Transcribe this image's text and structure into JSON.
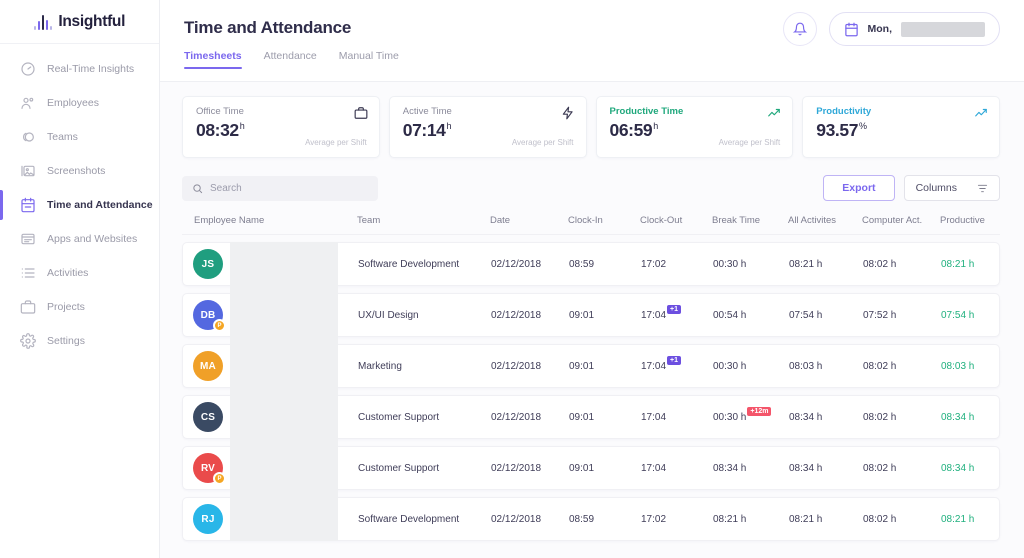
{
  "brand": {
    "name": "Insightful",
    "logo_icon": "waveform-icon",
    "accent": "#7b68ee"
  },
  "sidebar": {
    "items": [
      {
        "label": "Real-Time Insights",
        "icon": "gauge-icon",
        "active": false
      },
      {
        "label": "Employees",
        "icon": "people-icon",
        "active": false
      },
      {
        "label": "Teams",
        "icon": "teams-circles-icon",
        "active": false
      },
      {
        "label": "Screenshots",
        "icon": "image-icon",
        "active": false
      },
      {
        "label": "Time and Attendance",
        "icon": "calendar-icon",
        "active": true
      },
      {
        "label": "Apps and Websites",
        "icon": "window-list-icon",
        "active": false
      },
      {
        "label": "Activities",
        "icon": "list-icon",
        "active": false
      },
      {
        "label": "Projects",
        "icon": "briefcase-icon",
        "active": false
      },
      {
        "label": "Settings",
        "icon": "gear-icon",
        "active": false
      }
    ]
  },
  "header": {
    "title": "Time and Attendance",
    "tabs": [
      {
        "label": "Timesheets",
        "active": true
      },
      {
        "label": "Attendance",
        "active": false
      },
      {
        "label": "Manual Time",
        "active": false
      }
    ],
    "notifications_icon": "bell-icon",
    "date_picker": {
      "icon": "calendar-icon",
      "label": "Mon,",
      "value_redacted": true
    }
  },
  "cards": [
    {
      "title": "Office Time",
      "value": "08:32",
      "unit": "h",
      "sub": "Average per Shift",
      "icon": "briefcase-icon",
      "color": "dark"
    },
    {
      "title": "Active Time",
      "value": "07:14",
      "unit": "h",
      "sub": "Average per Shift",
      "icon": "lightning-icon",
      "color": "dark"
    },
    {
      "title": "Productive Time",
      "value": "06:59",
      "unit": "h",
      "sub": "Average per Shift",
      "icon": "trend-up-icon",
      "color": "green"
    },
    {
      "title": "Productivity",
      "value": "93.57",
      "unit": "%",
      "sub": "",
      "icon": "trend-up-icon",
      "color": "blue"
    }
  ],
  "toolbar": {
    "search_placeholder": "Search",
    "search_value": "",
    "search_icon": "search-icon",
    "export_label": "Export",
    "columns_label": "Columns",
    "columns_icon": "filter-icon"
  },
  "table": {
    "columns": [
      "Employee Name",
      "Team",
      "Date",
      "Clock-In",
      "Clock-Out",
      "Break Time",
      "All Activites",
      "Computer Act.",
      "Productive"
    ],
    "rows": [
      {
        "initials": "JS",
        "avatar_color": "#1f9e7f",
        "badge": "",
        "name_redacted": true,
        "team": "Software Development",
        "date": "02/12/2018",
        "clock_in": "08:59",
        "clock_out": "17:02",
        "clock_out_badge": "",
        "break_time": "00:30 h",
        "break_badge": "",
        "all_activities": "08:21 h",
        "computer_act": "08:02 h",
        "productive": "08:21 h"
      },
      {
        "initials": "DB",
        "avatar_color": "#5468e0",
        "badge": "P",
        "name_redacted": true,
        "team": "UX/UI Design",
        "date": "02/12/2018",
        "clock_in": "09:01",
        "clock_out": "17:04",
        "clock_out_badge": "+1",
        "break_time": "00:54 h",
        "break_badge": "",
        "all_activities": "07:54 h",
        "computer_act": "07:52 h",
        "productive": "07:54 h"
      },
      {
        "initials": "MA",
        "avatar_color": "#f0a028",
        "badge": "",
        "name_redacted": true,
        "team": "Marketing",
        "date": "02/12/2018",
        "clock_in": "09:01",
        "clock_out": "17:04",
        "clock_out_badge": "+1",
        "break_time": "00:30 h",
        "break_badge": "",
        "all_activities": "08:03 h",
        "computer_act": "08:02 h",
        "productive": "08:03 h"
      },
      {
        "initials": "CS",
        "avatar_color": "#3a4a63",
        "badge": "",
        "name_redacted": true,
        "team": "Customer Support",
        "date": "02/12/2018",
        "clock_in": "09:01",
        "clock_out": "17:04",
        "clock_out_badge": "",
        "break_time": "00:30 h",
        "break_badge": "+12m",
        "all_activities": "08:34 h",
        "computer_act": "08:02 h",
        "productive": "08:34 h"
      },
      {
        "initials": "RV",
        "avatar_color": "#ea4b4b",
        "badge": "P",
        "name_redacted": true,
        "team": "Customer Support",
        "date": "02/12/2018",
        "clock_in": "09:01",
        "clock_out": "17:04",
        "clock_out_badge": "",
        "break_time": "08:34 h",
        "break_badge": "",
        "all_activities": "08:34 h",
        "computer_act": "08:02 h",
        "productive": "08:34 h"
      },
      {
        "initials": "RJ",
        "avatar_color": "#29b6e8",
        "badge": "",
        "name_redacted": true,
        "team": "Software Development",
        "date": "02/12/2018",
        "clock_in": "08:59",
        "clock_out": "17:02",
        "clock_out_badge": "",
        "break_time": "08:21 h",
        "break_badge": "",
        "all_activities": "08:21 h",
        "computer_act": "08:02 h",
        "productive": "08:21 h"
      }
    ]
  }
}
